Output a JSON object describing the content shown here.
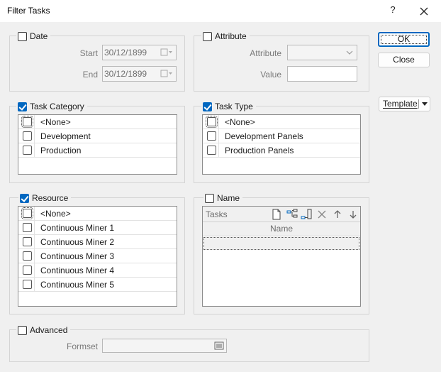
{
  "window": {
    "title": "Filter Tasks",
    "help_label": "?"
  },
  "date": {
    "label": "Date",
    "checked": false,
    "start_label": "Start",
    "start_value": "30/12/1899",
    "end_label": "End",
    "end_value": "30/12/1899"
  },
  "attribute": {
    "label": "Attribute",
    "checked": false,
    "attribute_label": "Attribute",
    "attribute_value": "",
    "value_label": "Value",
    "value_value": ""
  },
  "task_category": {
    "label": "Task Category",
    "checked": true,
    "items": [
      {
        "label": "<None>",
        "checked": false
      },
      {
        "label": "Development",
        "checked": false
      },
      {
        "label": "Production",
        "checked": false
      }
    ]
  },
  "task_type": {
    "label": "Task Type",
    "checked": true,
    "items": [
      {
        "label": "<None>",
        "checked": false
      },
      {
        "label": "Development Panels",
        "checked": false
      },
      {
        "label": "Production Panels",
        "checked": false
      }
    ]
  },
  "resource": {
    "label": "Resource",
    "checked": true,
    "items": [
      {
        "label": "<None>",
        "checked": false
      },
      {
        "label": "Continuous Miner 1",
        "checked": false
      },
      {
        "label": "Continuous Miner 2",
        "checked": false
      },
      {
        "label": "Continuous Miner 3",
        "checked": false
      },
      {
        "label": "Continuous Miner 4",
        "checked": false
      },
      {
        "label": "Continuous Miner 5",
        "checked": false
      }
    ]
  },
  "name": {
    "label": "Name",
    "checked": false,
    "panel_title": "Tasks",
    "column_header": "Name"
  },
  "advanced": {
    "label": "Advanced",
    "checked": false,
    "formset_label": "Formset",
    "formset_value": ""
  },
  "buttons": {
    "ok": "OK",
    "close": "Close",
    "template": "Template"
  },
  "colors": {
    "accent": "#0067c0",
    "border": "#d4d4d4",
    "background": "#f0f0f0"
  }
}
